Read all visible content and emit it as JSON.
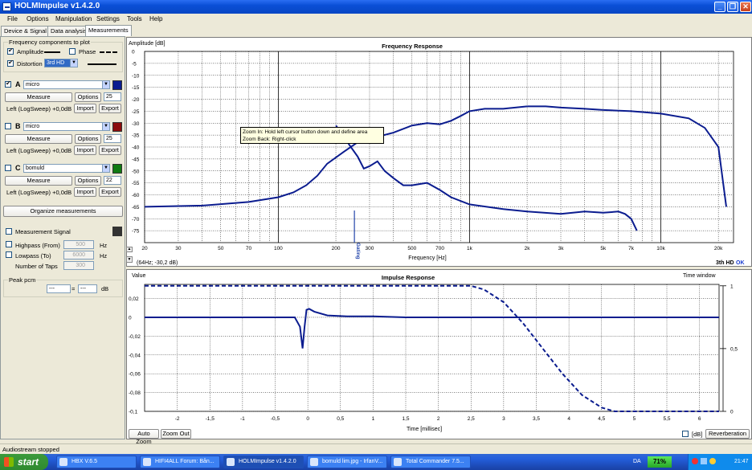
{
  "window": {
    "title": "HOLMImpulse  v1.4.2.0"
  },
  "menu": [
    "File",
    "Options",
    "Manipulation",
    "Settings",
    "Tools",
    "Help"
  ],
  "tabs": [
    "Device & Signal",
    "Data analysis",
    "Measurements"
  ],
  "freq_components": {
    "label": "Frequency components to plot",
    "amplitude": "Amplitude",
    "phase": "Phase",
    "distortion": "Distortion",
    "distortion_value": "3rd HD"
  },
  "measurements": [
    {
      "letter": "A",
      "name": "micro",
      "checked": true,
      "measure": "Measure",
      "options": "Options",
      "spin": "25",
      "info": "Left (LogSweep) +0,0dB",
      "import": "Import",
      "export": "Export",
      "color": "#0b1c8f"
    },
    {
      "letter": "B",
      "name": "micro",
      "checked": false,
      "measure": "Measure",
      "options": "Options",
      "spin": "25",
      "info": "Left (LogSweep) +0,0dB",
      "import": "Import",
      "export": "Export",
      "color": "#8c0c0c"
    },
    {
      "letter": "C",
      "name": "bomuld",
      "checked": false,
      "measure": "Measure",
      "options": "Options",
      "spin": "22",
      "info": "Left (LogSweep) +0,0dB",
      "import": "Import",
      "export": "Export",
      "color": "#107a10"
    }
  ],
  "organize": "Organize measurements",
  "signal": {
    "label": "Measurement Signal",
    "highpass": "Highpass (From)",
    "highpass_val": "500",
    "lowpass": "Lowpass (To)",
    "lowpass_val": "6000",
    "taps": "Number of Taps",
    "taps_val": "300",
    "hz": "Hz"
  },
  "peak": {
    "label": "Peak pcm",
    "val1": "---",
    "eq": "=",
    "val2": "---",
    "unit": "dB"
  },
  "freq_plot": {
    "ylabel": "Amplitude [dB]",
    "title": "Frequency Response",
    "xlabel": "Frequency [Hz]",
    "readout": "(64Hz; -30,2 dB)",
    "hd_label": "3th HD",
    "ok": "OK",
    "tooltip1": "Zoom In:  Hold left cursor button down and define area",
    "tooltip2": "Zoom Back: Right-click",
    "gating": "Gating"
  },
  "imp_plot": {
    "ylabel": "Value",
    "title": "Impulse Response",
    "window_label": "Time window",
    "xlabel": "Time [millisec]",
    "auto_zoom": "Auto Zoom",
    "zoom_out": "Zoom Out",
    "db": "[dB]",
    "reverb": "Reverberation"
  },
  "status": "Audiostream stopped",
  "taskbar": {
    "start": "start",
    "items": [
      "HBX V.6.5",
      "HIFI4ALL Forum: Bån...",
      "HOLMImpulse  v1.4.2.0",
      "bomuld lim.jpg - IrfanV...",
      "Total Commander 7.5..."
    ],
    "lang": "DA",
    "battery": "71%",
    "clock": "21:47"
  },
  "chart_data": [
    {
      "type": "line",
      "title": "Frequency Response",
      "xlabel": "Frequency [Hz]",
      "ylabel": "Amplitude [dB]",
      "xscale": "log",
      "xlim": [
        20,
        24000
      ],
      "ylim": [
        -80,
        0
      ],
      "x_ticks": [
        20,
        30,
        50,
        70,
        100,
        200,
        300,
        500,
        700,
        "1k",
        "2k",
        "3k",
        "5k",
        "7k",
        "10k",
        "20k"
      ],
      "y_ticks": [
        0,
        -5,
        -10,
        -15,
        -20,
        -25,
        -30,
        -35,
        -40,
        -45,
        -50,
        -55,
        -60,
        -65,
        -70,
        -75
      ],
      "series": [
        {
          "style": "solid",
          "x": [
            20,
            40,
            70,
            100,
            120,
            140,
            160,
            180,
            220,
            260,
            320,
            400,
            500,
            600,
            700,
            800,
            900,
            1000,
            1200,
            1500,
            2000,
            2500,
            3000,
            4000,
            5000,
            7000,
            10000,
            14000,
            17000,
            20000,
            22000
          ],
          "y": [
            -65,
            -64.5,
            -63,
            -61,
            -59,
            -56,
            -52,
            -47,
            -42,
            -38,
            -36,
            -34,
            -31,
            -30,
            -30.5,
            -29,
            -27,
            -25,
            -24,
            -24,
            -23,
            -23,
            -23.5,
            -24,
            -24.5,
            -25,
            -26,
            -28,
            -32,
            -40,
            -65
          ]
        },
        {
          "style": "solid",
          "x": [
            200,
            230,
            260,
            280,
            300,
            330,
            360,
            400,
            450,
            500,
            600,
            700,
            800,
            1000,
            1500,
            2000,
            3000,
            4000,
            5000,
            6000,
            6500,
            7000,
            7500
          ],
          "y": [
            -31,
            -38,
            -44,
            -49,
            -48,
            -46,
            -50,
            -53,
            -56,
            -56,
            -55,
            -58,
            -61,
            -64,
            -66,
            -67,
            -68,
            -67,
            -67.5,
            -67,
            -68,
            -70,
            -75
          ]
        }
      ]
    },
    {
      "type": "line",
      "title": "Impulse Response",
      "xlabel": "Time [millisec]",
      "ylabel": "Value",
      "xlim": [
        -2.5,
        6.3
      ],
      "ylim": [
        -0.1,
        0.035
      ],
      "x_ticks": [
        "-2",
        "-1,5",
        "-1",
        "-0,5",
        "0",
        "0,5",
        "1",
        "1,5",
        "2",
        "2,5",
        "3",
        "3,5",
        "4",
        "4,5",
        "5",
        "5,5",
        "6"
      ],
      "y_ticks": [
        "0,02",
        "0",
        "-0,02",
        "-0,04",
        "-0,06",
        "-0,08",
        "-0,1"
      ],
      "right_ticks": [
        "1",
        "0,5",
        "0"
      ],
      "series": [
        {
          "name": "impulse",
          "style": "solid",
          "x": [
            -2.5,
            -0.2,
            -0.12,
            -0.08,
            -0.05,
            -0.02,
            0.02,
            0.1,
            0.3,
            0.6,
            1.0,
            1.5,
            2,
            3,
            6.3
          ],
          "y": [
            0,
            0,
            -0.01,
            -0.033,
            -0.01,
            0.008,
            0.009,
            0.006,
            0.002,
            0.001,
            0.001,
            0,
            0,
            0,
            0
          ]
        },
        {
          "name": "time-window",
          "style": "dashed",
          "x": [
            -2.5,
            2.5,
            2.7,
            3,
            3.3,
            3.6,
            3.9,
            4.2,
            4.5,
            4.7,
            6.3
          ],
          "y": [
            1,
            1,
            0.97,
            0.87,
            0.7,
            0.5,
            0.3,
            0.13,
            0.03,
            0,
            0
          ]
        }
      ]
    }
  ]
}
